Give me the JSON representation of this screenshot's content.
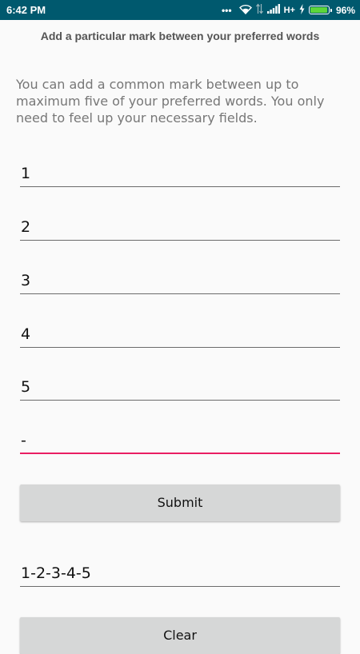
{
  "status_bar": {
    "time": "6:42 PM",
    "network": "H+",
    "battery_percent": "96%",
    "battery_level": 0.96,
    "battery_color": "#5cd63a",
    "background_color": "#00596e"
  },
  "header": {
    "title": "Add a particular mark between your preferred words"
  },
  "description": "You can add a common mark between up to maximum five of your preferred words. You only need to feel up your necessary fields.",
  "fields": [
    {
      "value": "1"
    },
    {
      "value": "2"
    },
    {
      "value": "3"
    },
    {
      "value": "4"
    },
    {
      "value": "5"
    }
  ],
  "mark_field": {
    "value": "-",
    "accent_color": "#e91e63"
  },
  "submit_label": "Submit",
  "result": "1-2-3-4-5",
  "clear_label": "Clear"
}
